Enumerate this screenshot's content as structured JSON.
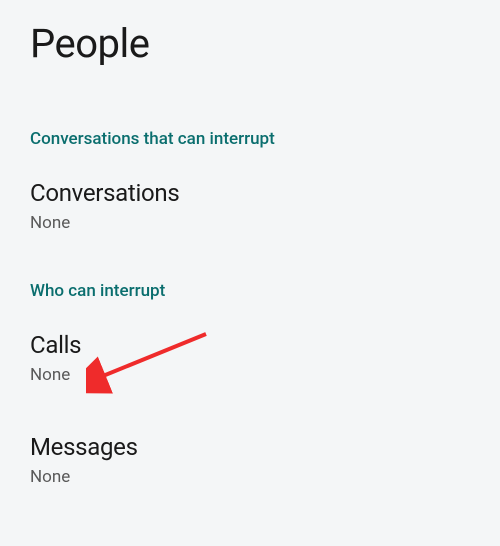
{
  "page": {
    "title": "People"
  },
  "sections": [
    {
      "header": "Conversations that can interrupt",
      "items": [
        {
          "title": "Conversations",
          "value": "None"
        }
      ]
    },
    {
      "header": "Who can interrupt",
      "items": [
        {
          "title": "Calls",
          "value": "None"
        },
        {
          "title": "Messages",
          "value": "None"
        }
      ]
    }
  ]
}
